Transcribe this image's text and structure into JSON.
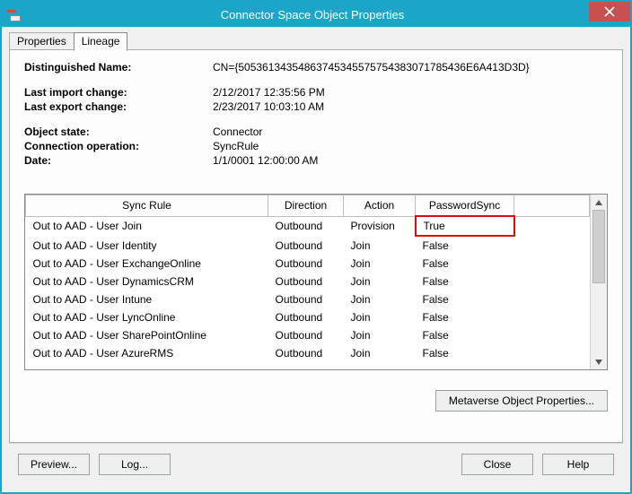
{
  "window": {
    "title": "Connector Space Object Properties",
    "close_tooltip": "Close"
  },
  "tabs": {
    "properties": "Properties",
    "lineage": "Lineage"
  },
  "fields": {
    "dn_label": "Distinguished Name:",
    "dn_value": "CN={50536134354863745345575754383071785436E6A413D3D}",
    "last_import_label": "Last import change:",
    "last_import_value": "2/12/2017 12:35:56 PM",
    "last_export_label": "Last export change:",
    "last_export_value": "2/23/2017 10:03:10 AM",
    "object_state_label": "Object state:",
    "object_state_value": "Connector",
    "conn_op_label": "Connection operation:",
    "conn_op_value": "SyncRule",
    "date_label": "Date:",
    "date_value": "1/1/0001 12:00:00 AM"
  },
  "columns": {
    "sync_rule": "Sync Rule",
    "direction": "Direction",
    "action": "Action",
    "password_sync": "PasswordSync"
  },
  "rows": [
    {
      "rule": "Out to AAD - User Join",
      "dir": "Outbound",
      "act": "Provision",
      "pw": "True",
      "hl": true
    },
    {
      "rule": "Out to AAD - User Identity",
      "dir": "Outbound",
      "act": "Join",
      "pw": "False",
      "hl": false
    },
    {
      "rule": "Out to AAD - User ExchangeOnline",
      "dir": "Outbound",
      "act": "Join",
      "pw": "False",
      "hl": false
    },
    {
      "rule": "Out to AAD - User DynamicsCRM",
      "dir": "Outbound",
      "act": "Join",
      "pw": "False",
      "hl": false
    },
    {
      "rule": "Out to AAD - User Intune",
      "dir": "Outbound",
      "act": "Join",
      "pw": "False",
      "hl": false
    },
    {
      "rule": "Out to AAD - User LyncOnline",
      "dir": "Outbound",
      "act": "Join",
      "pw": "False",
      "hl": false
    },
    {
      "rule": "Out to AAD - User SharePointOnline",
      "dir": "Outbound",
      "act": "Join",
      "pw": "False",
      "hl": false
    },
    {
      "rule": "Out to AAD - User AzureRMS",
      "dir": "Outbound",
      "act": "Join",
      "pw": "False",
      "hl": false
    }
  ],
  "buttons": {
    "mv_props": "Metaverse Object Properties...",
    "preview": "Preview...",
    "log": "Log...",
    "close": "Close",
    "help": "Help"
  }
}
